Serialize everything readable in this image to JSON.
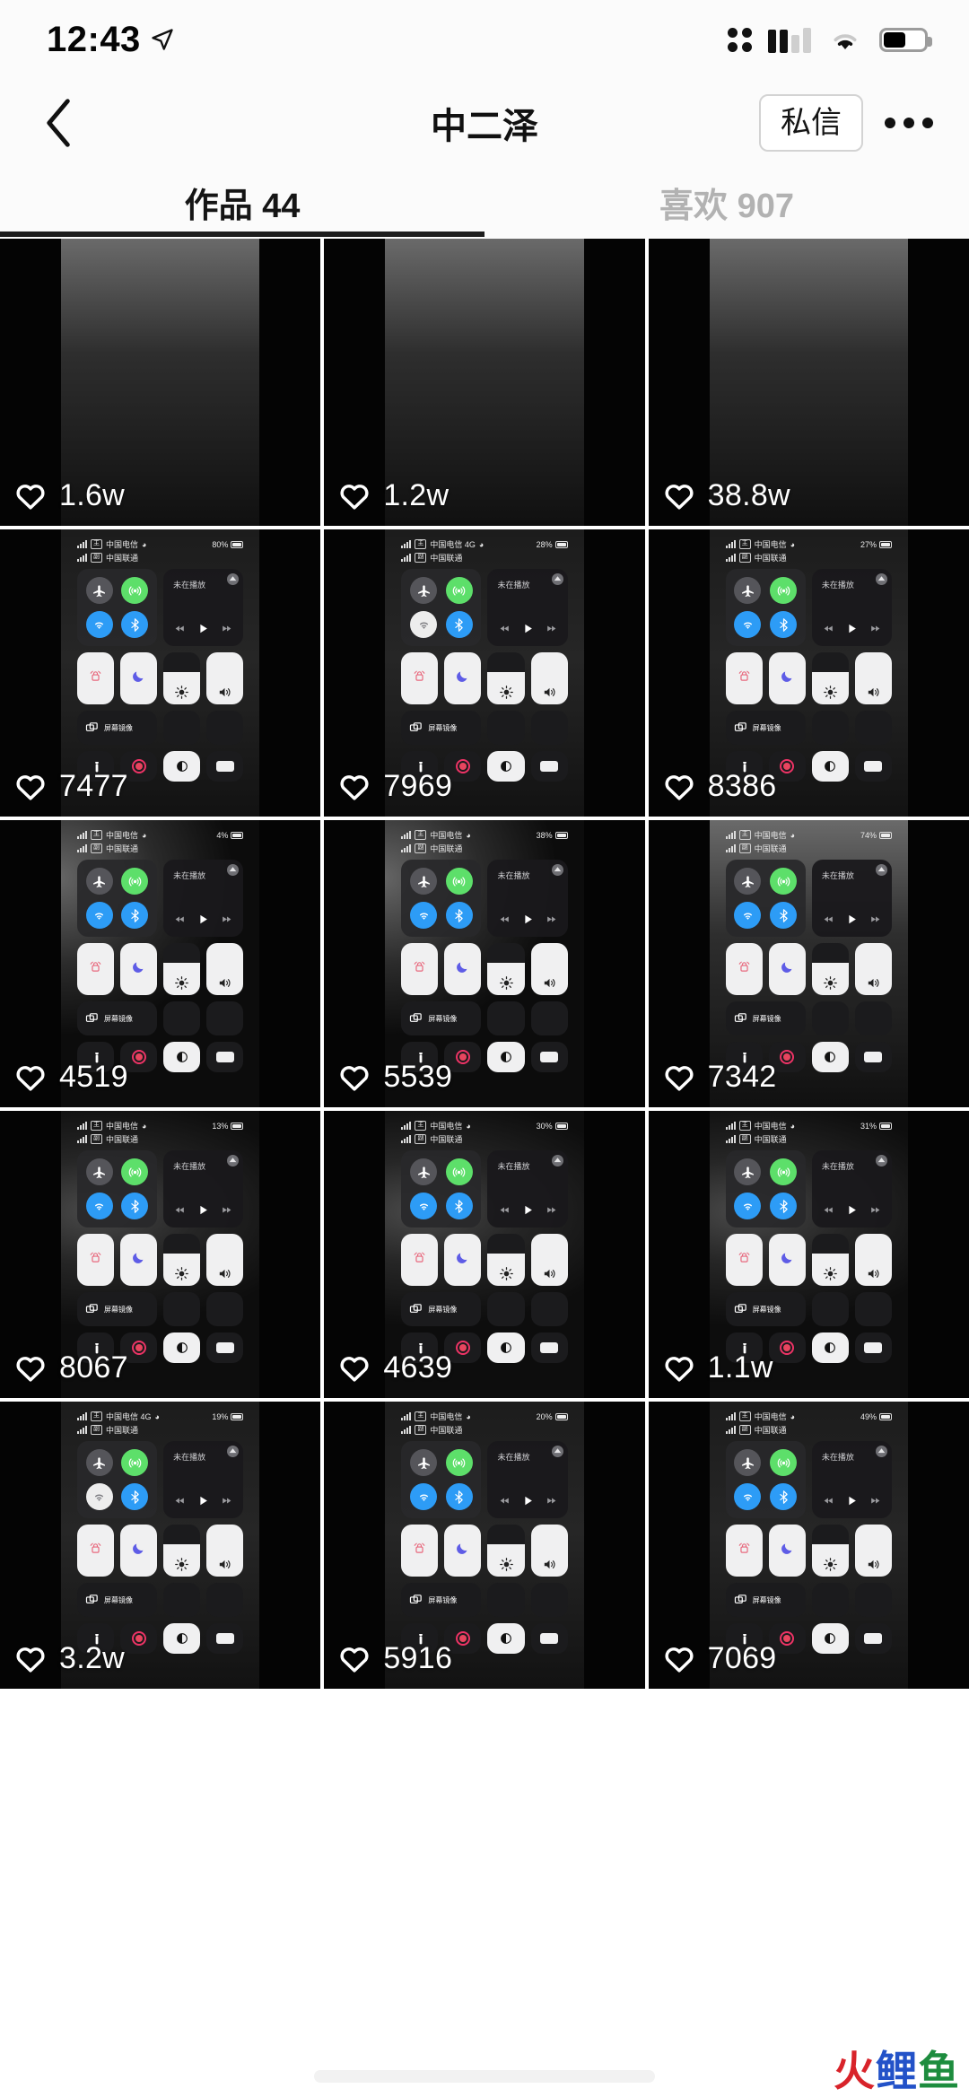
{
  "status_bar": {
    "time": "12:43",
    "location_icon": "location-arrow-icon",
    "signal_icon": "cellular-signal-icon",
    "wifi_icon": "wifi-icon",
    "battery_icon": "battery-icon"
  },
  "nav": {
    "back_icon": "chevron-left-icon",
    "title": "中二泽",
    "message_button": "私信",
    "more_icon": "more-horizontal-icon"
  },
  "tabs": [
    {
      "label": "作品 44",
      "active": true
    },
    {
      "label": "喜欢 907",
      "active": false
    }
  ],
  "grid": {
    "items": [
      {
        "likes": "1.6w",
        "style": "grey",
        "cc": false
      },
      {
        "likes": "1.2w",
        "style": "grey",
        "cc": false
      },
      {
        "likes": "38.8w",
        "style": "grey",
        "cc": false
      },
      {
        "likes": "7477",
        "style": "dark",
        "cc": true,
        "cc_status": {
          "carrier1": "中国电信",
          "carrier2": "中国联通",
          "tag1": "主",
          "tag2": "副",
          "battery": "80%"
        },
        "media_text": "未在播放",
        "toggles": [
          "airplane-grey",
          "hotspot-green",
          "wifi-blue",
          "bluetooth-blue"
        ]
      },
      {
        "likes": "7969",
        "style": "dark",
        "cc": true,
        "cc_status": {
          "carrier1": "中国电信 4G",
          "carrier2": "中国联通",
          "tag1": "主",
          "tag2": "副",
          "battery": "28%"
        },
        "media_text": "未在播放",
        "toggles": [
          "airplane-grey",
          "hotspot-green",
          "wifi-white",
          "bluetooth-blue"
        ]
      },
      {
        "likes": "8386",
        "style": "dark",
        "cc": true,
        "cc_status": {
          "carrier1": "中国电信",
          "carrier2": "中国联通",
          "tag1": "主",
          "tag2": "副",
          "battery": "27%"
        },
        "media_text": "未在播放",
        "toggles": [
          "airplane-grey",
          "hotspot-green",
          "wifi-blue",
          "bluetooth-blue"
        ]
      },
      {
        "likes": "4519",
        "style": "rock",
        "cc": true,
        "cc_status": {
          "carrier1": "中国电信",
          "carrier2": "中国联通",
          "tag1": "主",
          "tag2": "副",
          "battery": "4%"
        },
        "media_text": "未在播放",
        "toggles": [
          "airplane-grey",
          "hotspot-green",
          "wifi-blue",
          "bluetooth-blue"
        ]
      },
      {
        "likes": "5539",
        "style": "rock",
        "cc": true,
        "cc_status": {
          "carrier1": "中国电信",
          "carrier2": "中国联通",
          "tag1": "主",
          "tag2": "副",
          "battery": "38%"
        },
        "media_text": "未在播放",
        "toggles": [
          "airplane-grey",
          "hotspot-green",
          "wifi-blue",
          "bluetooth-blue"
        ]
      },
      {
        "likes": "7342",
        "style": "grey",
        "cc": true,
        "cc_status": {
          "carrier1": "中国电信",
          "carrier2": "中国联通",
          "tag1": "主",
          "tag2": "副",
          "battery": "74%"
        },
        "media_text": "未在播放",
        "toggles": [
          "airplane-grey",
          "hotspot-green",
          "wifi-blue",
          "bluetooth-blue"
        ]
      },
      {
        "likes": "8067",
        "style": "moon",
        "cc": true,
        "cc_status": {
          "carrier1": "中国电信",
          "carrier2": "中国联通",
          "tag1": "主",
          "tag2": "副",
          "battery": "13%"
        },
        "media_text": "未在播放",
        "toggles": [
          "airplane-grey",
          "hotspot-green",
          "wifi-blue",
          "bluetooth-blue"
        ]
      },
      {
        "likes": "4639",
        "style": "moon",
        "cc": true,
        "cc_status": {
          "carrier1": "中国电信",
          "carrier2": "中国联通",
          "tag1": "主",
          "tag2": "副",
          "battery": "30%"
        },
        "media_text": "未在播放",
        "toggles": [
          "airplane-grey",
          "hotspot-green",
          "wifi-blue",
          "bluetooth-blue"
        ]
      },
      {
        "likes": "1.1w",
        "style": "moon",
        "cc": true,
        "cc_status": {
          "carrier1": "中国电信",
          "carrier2": "中国联通",
          "tag1": "主",
          "tag2": "副",
          "battery": "31%"
        },
        "media_text": "未在播放",
        "toggles": [
          "airplane-grey",
          "hotspot-green",
          "wifi-blue",
          "bluetooth-blue"
        ]
      },
      {
        "likes": "3.2w",
        "style": "dark",
        "cc": true,
        "cc_status": {
          "carrier1": "中国电信 4G",
          "carrier2": "中国联通",
          "tag1": "主",
          "tag2": "副",
          "battery": "19%"
        },
        "media_text": "未在播放",
        "toggles": [
          "airplane-grey",
          "hotspot-green",
          "wifi-white",
          "bluetooth-blue"
        ]
      },
      {
        "likes": "5916",
        "style": "dark",
        "cc": true,
        "cc_status": {
          "carrier1": "中国电信",
          "carrier2": "中国联通",
          "tag1": "主",
          "tag2": "副",
          "battery": "20%"
        },
        "media_text": "未在播放",
        "toggles": [
          "airplane-grey",
          "hotspot-green",
          "wifi-blue",
          "bluetooth-blue"
        ]
      },
      {
        "likes": "7069",
        "style": "dark",
        "cc": true,
        "cc_status": {
          "carrier1": "中国电信",
          "carrier2": "中国联通",
          "tag1": "主",
          "tag2": "副",
          "battery": "49%"
        },
        "media_text": "未在播放",
        "toggles": [
          "airplane-grey",
          "hotspot-green",
          "wifi-blue",
          "bluetooth-blue"
        ]
      }
    ]
  },
  "watermark": {
    "c1": "火",
    "c2": "鲤",
    "c3": "鱼"
  },
  "colors": {
    "page_bg": "#fbfbfb",
    "text_primary": "#151515",
    "text_muted": "#b2b2b2",
    "accent_green": "#5ddf6a",
    "accent_blue": "#2d9cf6",
    "tab_underline": "#1d1d1d"
  }
}
